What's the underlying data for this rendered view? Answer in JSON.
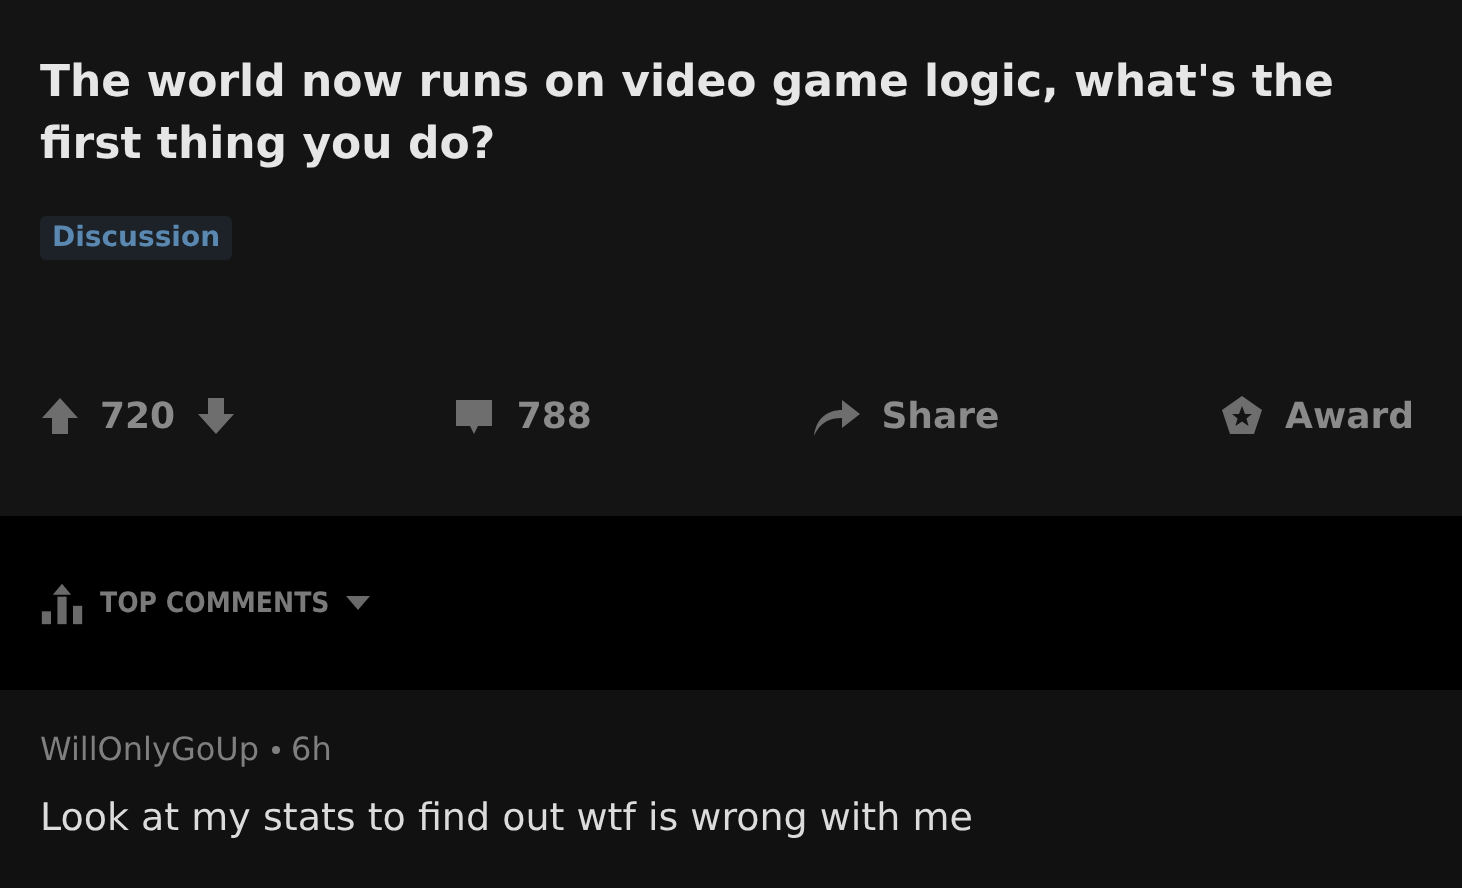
{
  "post": {
    "title": "The world now runs on video game logic, what's the first thing you do?",
    "flair": "Discussion",
    "actions": {
      "score": "720",
      "comments": "788",
      "share": "Share",
      "award": "Award"
    }
  },
  "sort": {
    "label": "TOP COMMENTS"
  },
  "comment": {
    "author": "WillOnlyGoUp",
    "time": "6h",
    "body": "Look at my stats to find out wtf is wrong with me"
  }
}
